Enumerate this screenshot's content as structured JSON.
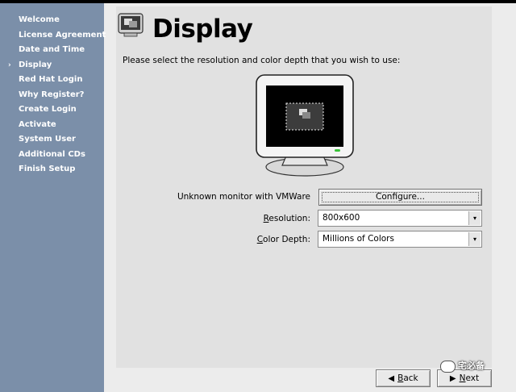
{
  "sidebar": {
    "items": [
      {
        "label": "Welcome"
      },
      {
        "label": "License Agreement"
      },
      {
        "label": "Date and Time"
      },
      {
        "label": "Display",
        "current": true
      },
      {
        "label": "Red Hat Login"
      },
      {
        "label": "Why Register?"
      },
      {
        "label": "Create Login"
      },
      {
        "label": "Activate"
      },
      {
        "label": "System User"
      },
      {
        "label": "Additional CDs"
      },
      {
        "label": "Finish Setup"
      }
    ],
    "current_marker": "›"
  },
  "main": {
    "title": "Display",
    "title_icon": "display-icon",
    "intro": "Please select the resolution and color depth that you wish to use:",
    "monitor_label": "Unknown monitor with VMWare",
    "configure_label": "Configure...",
    "resolution": {
      "label_mnemonic": "R",
      "label_rest": "esolution:",
      "value": "800x600"
    },
    "color_depth": {
      "label_mnemonic": "C",
      "label_rest": "olor Depth:",
      "value": "Millions of Colors"
    }
  },
  "nav": {
    "back_mnemonic": "B",
    "back_rest": "ack",
    "next_mnemonic": "N",
    "next_rest": "ext"
  },
  "watermark": {
    "text": "宅必备"
  },
  "colors": {
    "sidebar": "#7b8fa9",
    "content_bg": "#e1e1e1",
    "window_bg": "#ececec"
  }
}
